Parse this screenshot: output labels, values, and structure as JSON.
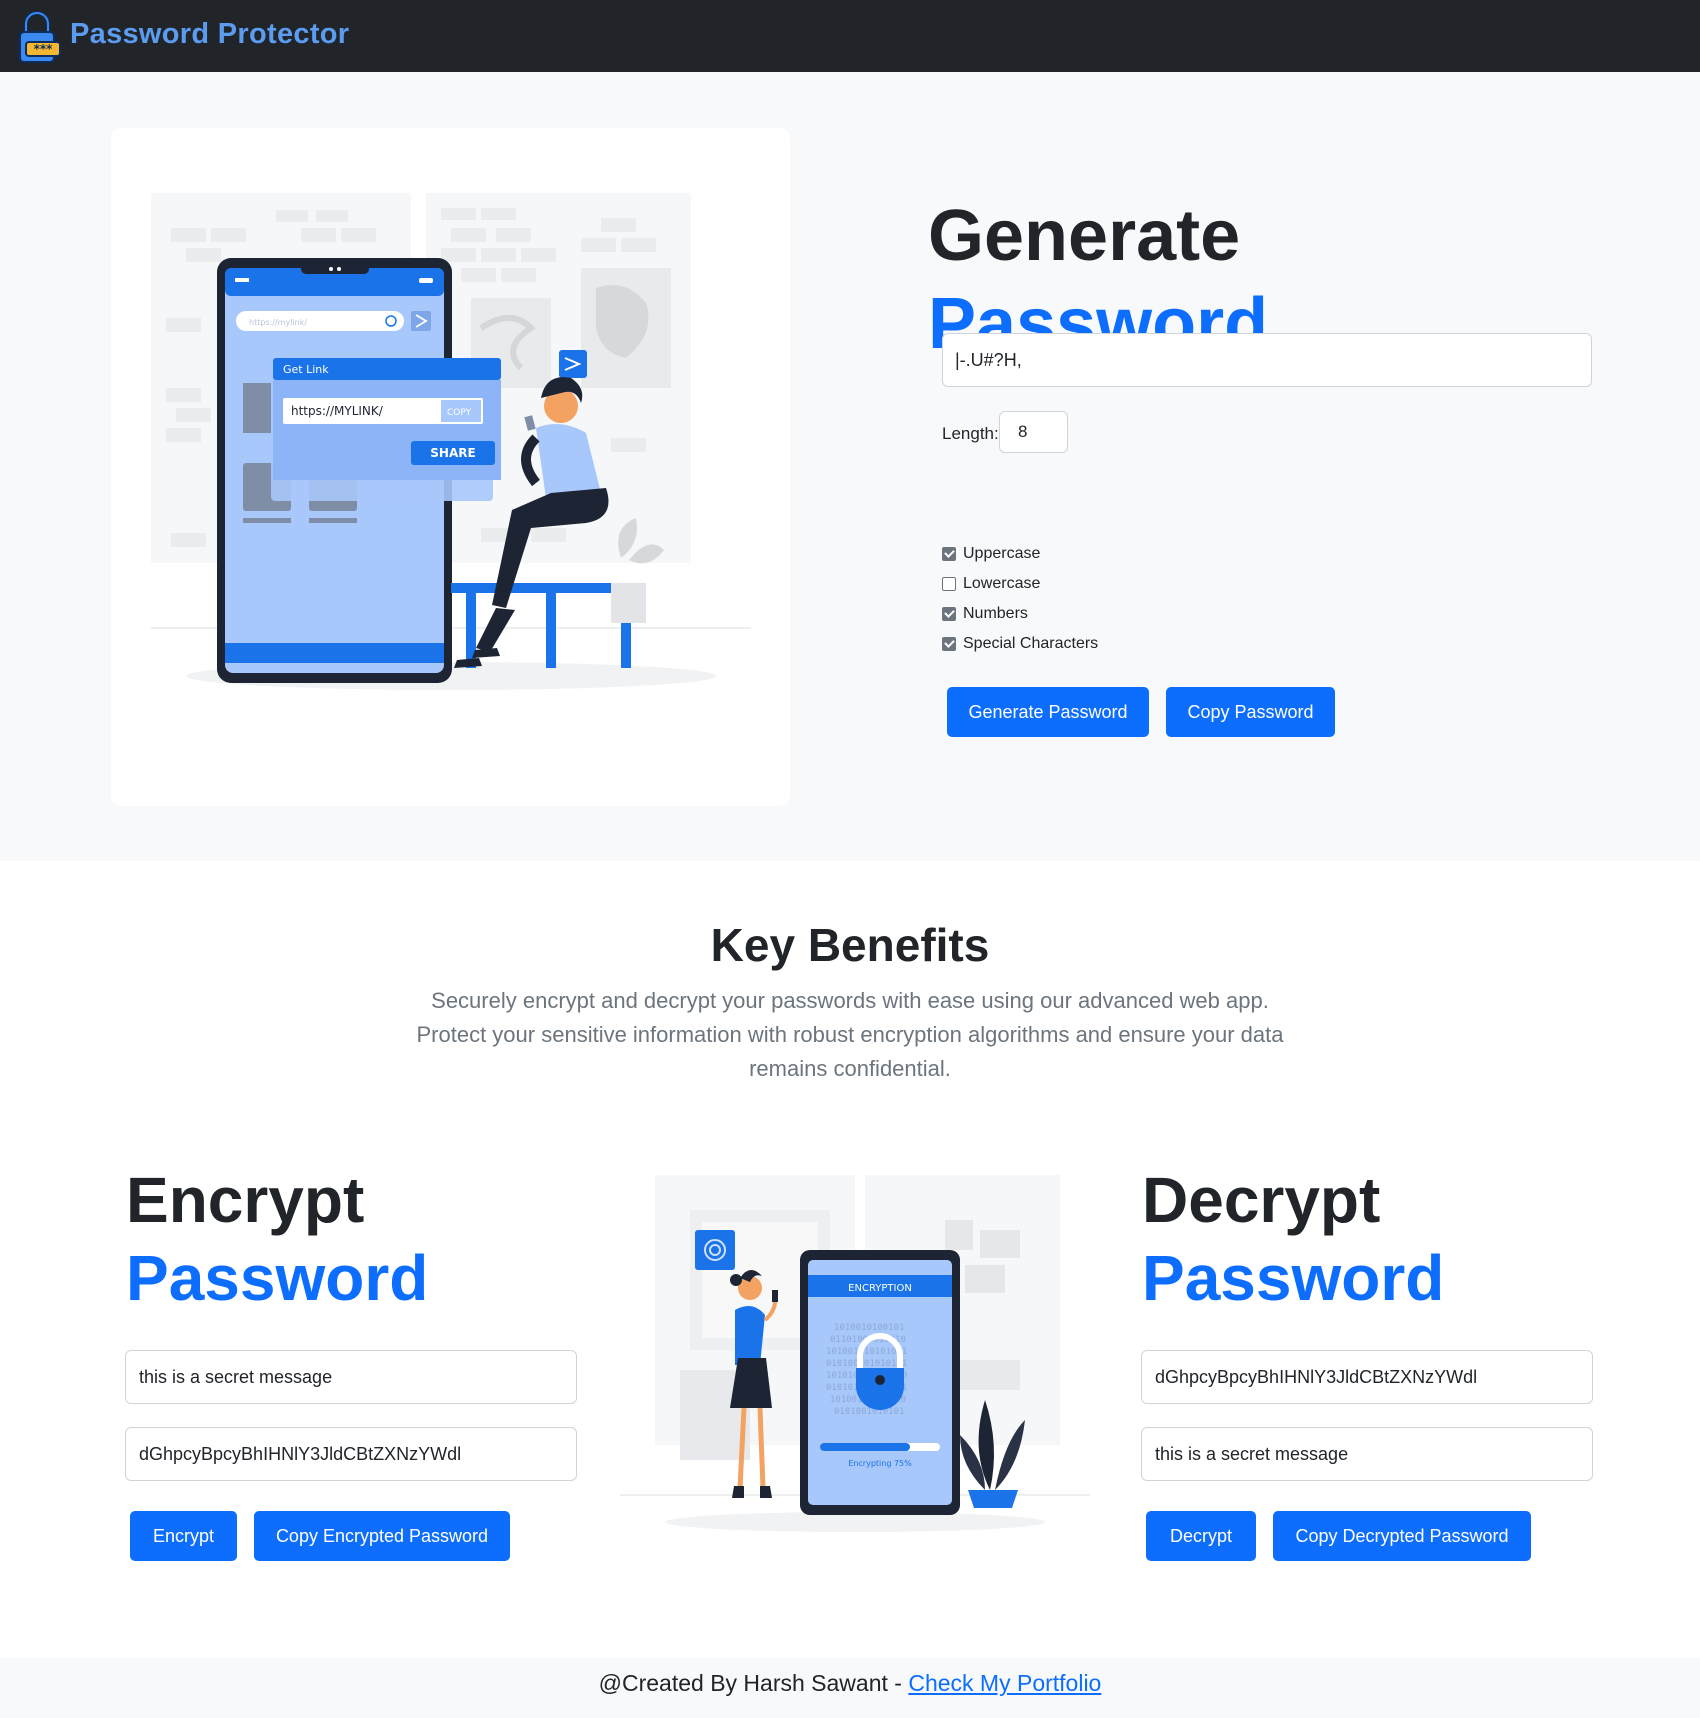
{
  "navbar": {
    "brand": "Password Protector",
    "logo_icon": "lock-password-icon"
  },
  "generator": {
    "title_line1": "Generate",
    "title_line2": "Password",
    "output_value": "|-.U#?H,",
    "length_label": "Length:",
    "length_value": "8",
    "options": [
      {
        "label": "Uppercase",
        "checked": true
      },
      {
        "label": "Lowercase",
        "checked": false
      },
      {
        "label": "Numbers",
        "checked": true
      },
      {
        "label": "Special Characters",
        "checked": true
      }
    ],
    "generate_button": "Generate Password",
    "copy_button": "Copy Password",
    "illustration": {
      "search_placeholder": "https://mylink/",
      "card_title": "Get Link",
      "link_text": "https://MYLINK/",
      "copy_label": "COPY",
      "share_label": "SHARE"
    }
  },
  "benefits": {
    "title": "Key Benefits",
    "text": "Securely encrypt and decrypt your passwords with ease using our advanced web app. Protect your sensitive information with robust encryption algorithms and ensure your data remains confidential."
  },
  "encrypt": {
    "title_line1": "Encrypt",
    "title_line2": "Password",
    "input_value": "this is a secret message",
    "output_value": "dGhpcyBpcyBhIHNlY3JldCBtZXNzYWdl",
    "encrypt_button": "Encrypt",
    "copy_button": "Copy Encrypted Password"
  },
  "decrypt": {
    "title_line1": "Decrypt",
    "title_line2": "Password",
    "input_value": "dGhpcyBpcyBhIHNlY3JldCBtZXNzYWdl",
    "output_value": "this is a secret message",
    "decrypt_button": "Decrypt",
    "copy_button": "Copy Decrypted Password"
  },
  "center_illustration": {
    "screen_title": "ENCRYPTION",
    "progress_label": "Encrypting 75%",
    "progress": 0.75
  },
  "footer": {
    "credit": "@Created By Harsh Sawant - ",
    "link_text": "Check My Portfolio"
  },
  "colors": {
    "primary": "#0d6efd",
    "dark": "#212529",
    "muted": "#6c757d",
    "brand": "#5b9bf0"
  }
}
